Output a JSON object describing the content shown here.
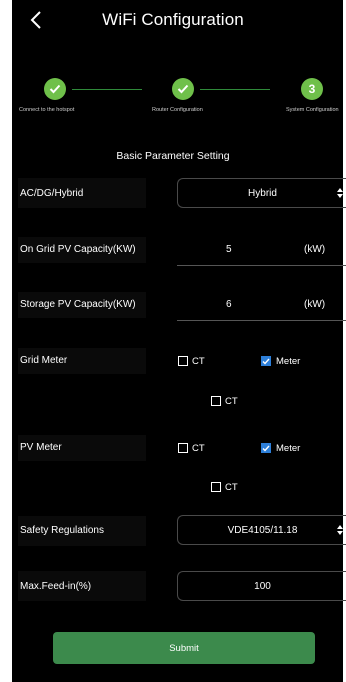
{
  "header": {
    "title": "WiFi Configuration",
    "back_icon": "chevron-left-icon"
  },
  "steps": [
    {
      "label": "Connect to the hotspot",
      "state": "done"
    },
    {
      "label": "Router Configuration",
      "state": "done"
    },
    {
      "label": "System Configuration",
      "state": "current",
      "number": "3"
    }
  ],
  "colors": {
    "step_green": "#6fc04a",
    "checkbox_blue": "#2d7fd9",
    "submit_green": "#3c8a4c"
  },
  "section_title": "Basic Parameter Setting",
  "form": {
    "mode": {
      "label": "AC/DG/Hybrid",
      "value": "Hybrid"
    },
    "on_grid_pv": {
      "label": "On Grid PV Capacity(KW)",
      "value": "5",
      "unit": "(kW)"
    },
    "storage_pv": {
      "label": "Storage PV Capacity(KW)",
      "value": "6",
      "unit": "(kW)"
    },
    "grid_meter": {
      "label": "Grid Meter",
      "option_ct": {
        "label": "CT",
        "checked": false
      },
      "option_meter": {
        "label": "Meter",
        "checked": true
      },
      "option_ct2": {
        "label": "CT",
        "checked": false
      }
    },
    "pv_meter": {
      "label": "PV Meter",
      "option_ct": {
        "label": "CT",
        "checked": false
      },
      "option_meter": {
        "label": "Meter",
        "checked": true
      },
      "option_ct2": {
        "label": "CT",
        "checked": false
      }
    },
    "safety": {
      "label": "Safety Regulations",
      "value": "VDE4105/11.18"
    },
    "max_feed_in": {
      "label": "Max.Feed-in(%)",
      "value": "100"
    }
  },
  "submit_label": "Submit"
}
